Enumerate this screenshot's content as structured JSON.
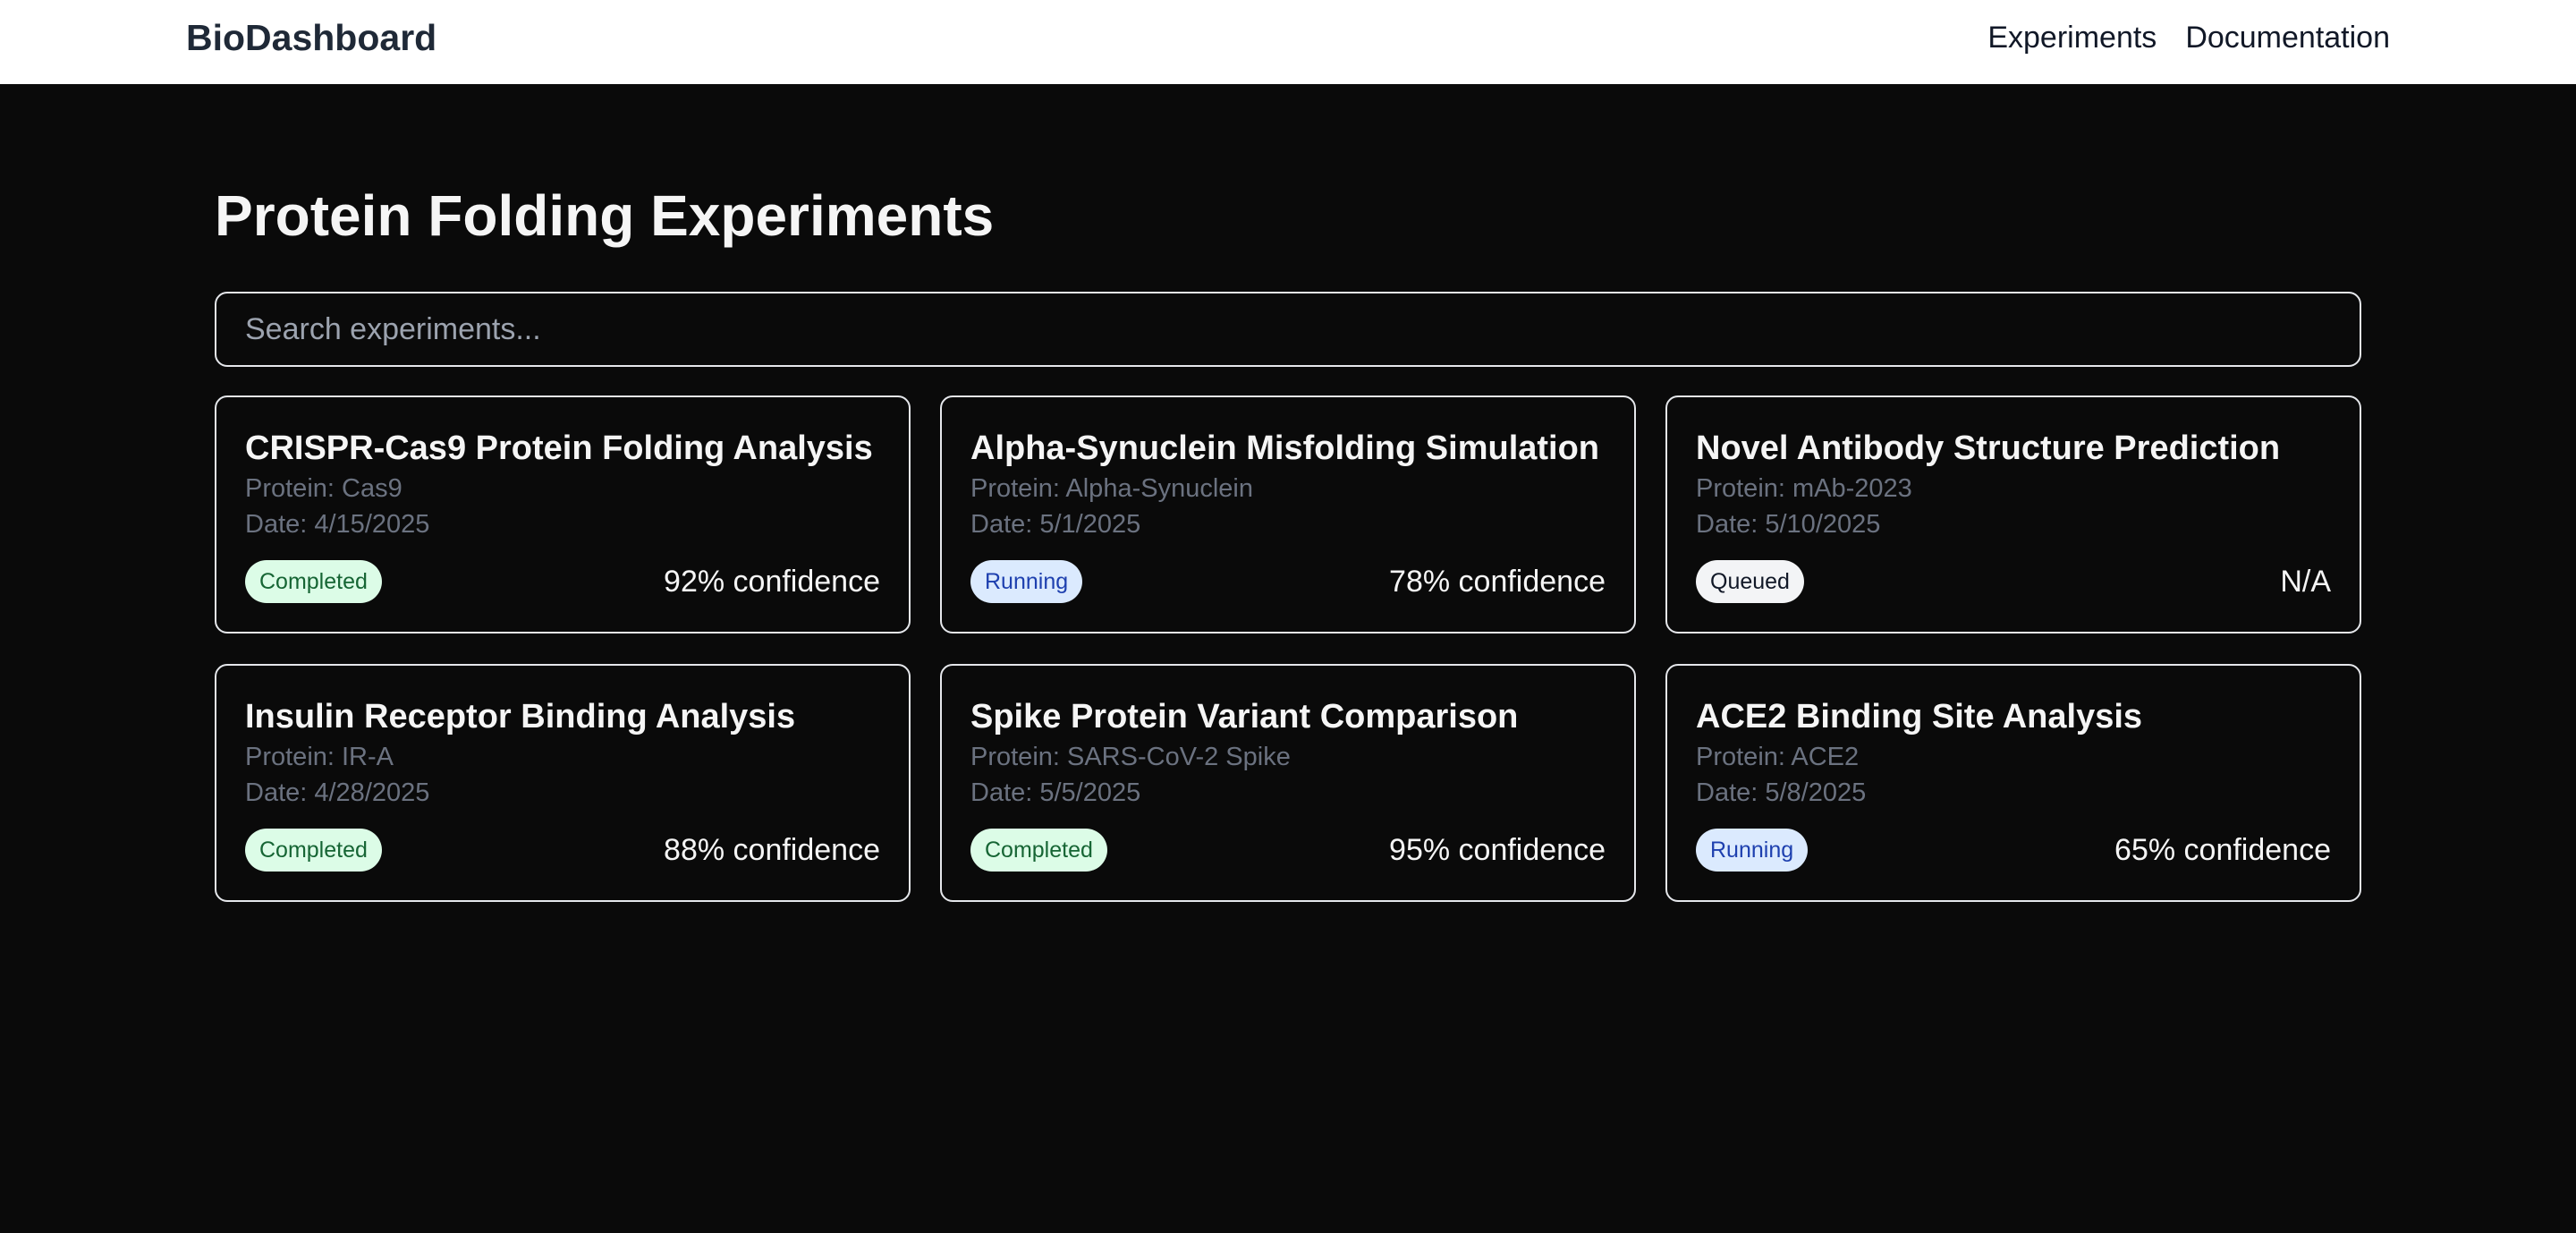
{
  "nav": {
    "brand": "BioDashboard",
    "links": [
      "Experiments",
      "Documentation"
    ]
  },
  "page": {
    "title": "Protein Folding Experiments"
  },
  "search": {
    "placeholder": "Search experiments...",
    "value": ""
  },
  "experiments": [
    {
      "title": "CRISPR-Cas9 Protein Folding Analysis",
      "protein": "Protein: Cas9",
      "date": "Date: 4/15/2025",
      "status": "Completed",
      "confidence": "92% confidence"
    },
    {
      "title": "Alpha-Synuclein Misfolding Simulation",
      "protein": "Protein: Alpha-Synuclein",
      "date": "Date: 5/1/2025",
      "status": "Running",
      "confidence": "78% confidence"
    },
    {
      "title": "Novel Antibody Structure Prediction",
      "protein": "Protein: mAb-2023",
      "date": "Date: 5/10/2025",
      "status": "Queued",
      "confidence": "N/A"
    },
    {
      "title": "Insulin Receptor Binding Analysis",
      "protein": "Protein: IR-A",
      "date": "Date: 4/28/2025",
      "status": "Completed",
      "confidence": "88% confidence"
    },
    {
      "title": "Spike Protein Variant Comparison",
      "protein": "Protein: SARS-CoV-2 Spike",
      "date": "Date: 5/5/2025",
      "status": "Completed",
      "confidence": "95% confidence"
    },
    {
      "title": "ACE2 Binding Site Analysis",
      "protein": "Protein: ACE2",
      "date": "Date: 5/8/2025",
      "status": "Running",
      "confidence": "65% confidence"
    }
  ],
  "colors": {
    "background": "#0a0a0a",
    "nav_background": "#ffffff",
    "completed_badge": "#dcfce7",
    "running_badge": "#dbeafe",
    "queued_badge": "#f3f4f6"
  }
}
